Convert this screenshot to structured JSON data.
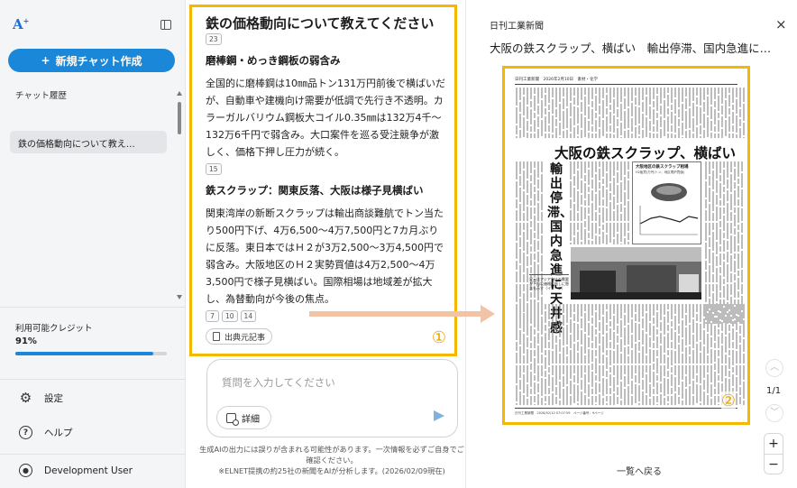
{
  "sidebar": {
    "logo": "A",
    "logo_sup": "+",
    "new_chat_label": "新規チャット作成",
    "history_title": "チャット履歴",
    "history_items": [
      "鉄の価格動向について教え…"
    ],
    "credit_label": "利用可能クレジット",
    "credit_value": "91%",
    "credit_fraction": 0.91,
    "settings_label": "設定",
    "help_label": "ヘルプ",
    "user_label": "Development User"
  },
  "answer": {
    "title": "鉄の価格動向について教えてください",
    "top_cite": "23",
    "sections": [
      {
        "heading": "磨棒鋼・めっき鋼板の弱含み",
        "body": "全国的に磨棒鋼は10㎜品トン131万円前後で横ばいだが、自動車や建機向け需要が低調で先行き不透明。カラーガルバリウム鋼板大コイル0.35㎜は132万4千～132万6千円で弱含み。大口案件を巡る受注競争が激しく、価格下押し圧力が続く。",
        "cites": [
          "15"
        ]
      },
      {
        "heading": "鉄スクラップ：関東反落、大阪は様子見横ばい",
        "body": "関東湾岸の新断スクラップは輸出商談難航でトン当たり500円下げ、4万6,500～4万7,500円と7カ月ぶりに反落。東日本ではＨ２が3万2,500～3万4,500円で弱含み。大阪地区のＨ２実勢買値は4万2,500～4万3,500円で様子見横ばい。国際相場は地域差が拡大し、為替動向が今後の焦点。",
        "cites": [
          "7",
          "10",
          "14"
        ]
      }
    ],
    "source_button": "出典元記事",
    "marker": "①"
  },
  "input": {
    "placeholder": "質問を入力してください",
    "detail_label": "詳細"
  },
  "disclaimer": {
    "line1": "生成AIの出力には誤りが含まれる可能性があります。一次情報を必ずご自身でご確認ください。",
    "line2": "※ELNET提携の約25社の新聞をAIが分析します。(2026/02/09現在)"
  },
  "viewer": {
    "publication": "日刊工業新聞",
    "article_title": "大阪の鉄スクラップ、横ばい　輸出停滞、国内急進に…",
    "close": "×",
    "page_indicator": "1/1",
    "marker": "②",
    "back_label": "一覧へ戻る",
    "zoom_in": "+",
    "zoom_out": "−",
    "nav_up": "︿",
    "nav_down": "﹀",
    "newspaper": {
      "masthead": "日刊工業新聞　2026年2月10日　素材・化学",
      "main_headline": "大阪の鉄スクラップ、横ばい",
      "vertical_headline": "輸出停滞、国内急進に天井感",
      "chart_title": "大阪地区の鉄スクラップ相場",
      "chart_sub": "H2胎買(万円/トン、地区電炉買値)",
      "caption": "足元はアジア向けの需要が下振れ価格見直しに懸念も示す（イメージ）",
      "footer": "日刊工業新聞　2026/02/10 07:07:59　ページ番号：9ページ"
    }
  }
}
